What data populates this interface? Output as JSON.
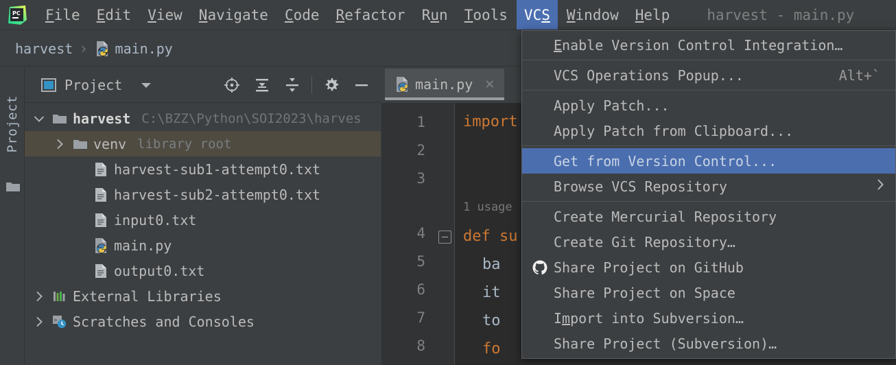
{
  "app": {
    "logo_icon": "pycharm-logo-icon",
    "window_title": "harvest - main.py"
  },
  "menubar": {
    "items": [
      {
        "label": "File",
        "mnemonic": "F",
        "active": false
      },
      {
        "label": "Edit",
        "mnemonic": "E",
        "active": false
      },
      {
        "label": "View",
        "mnemonic": "V",
        "active": false
      },
      {
        "label": "Navigate",
        "mnemonic": "N",
        "active": false
      },
      {
        "label": "Code",
        "mnemonic": "C",
        "active": false
      },
      {
        "label": "Refactor",
        "mnemonic": "R",
        "active": false
      },
      {
        "label": "Run",
        "mnemonic": "u",
        "active": false
      },
      {
        "label": "Tools",
        "mnemonic": "T",
        "active": false
      },
      {
        "label": "VCS",
        "mnemonic": "S",
        "active": true
      },
      {
        "label": "Window",
        "mnemonic": "W",
        "active": false
      },
      {
        "label": "Help",
        "mnemonic": "H",
        "active": false
      }
    ]
  },
  "breadcrumb": {
    "project": "harvest",
    "separator": "›",
    "file": "main.py",
    "file_icon": "python-file-icon"
  },
  "toolwindow_strip": {
    "label": "Project",
    "folder_icon": "folder-icon"
  },
  "project_panel": {
    "title": "Project",
    "title_icon": "project-view-icon",
    "dropdown_icon": "chevron-down-icon",
    "toolbar": [
      {
        "name": "locate-icon",
        "title": "Select Opened File"
      },
      {
        "name": "expand-all-icon",
        "title": "Expand All"
      },
      {
        "name": "collapse-all-icon",
        "title": "Collapse All"
      },
      {
        "name": "gear-icon",
        "title": "Settings"
      },
      {
        "name": "minimize-icon",
        "title": "Hide"
      }
    ],
    "tree": [
      {
        "label": "harvest",
        "detail": "C:\\BZZ\\Python\\SOI2023\\harves",
        "icon": "folder-icon",
        "arrow": "chevron-down-icon",
        "indent": 0,
        "bold": true,
        "selected": false
      },
      {
        "label": "venv",
        "detail": "library root",
        "icon": "folder-icon",
        "arrow": "chevron-right-icon",
        "indent": 1,
        "bold": false,
        "selected": true
      },
      {
        "label": "harvest-sub1-attempt0.txt",
        "detail": "",
        "icon": "text-file-icon",
        "arrow": "",
        "indent": 2,
        "bold": false,
        "selected": false
      },
      {
        "label": "harvest-sub2-attempt0.txt",
        "detail": "",
        "icon": "text-file-icon",
        "arrow": "",
        "indent": 2,
        "bold": false,
        "selected": false
      },
      {
        "label": "input0.txt",
        "detail": "",
        "icon": "text-file-icon",
        "arrow": "",
        "indent": 2,
        "bold": false,
        "selected": false
      },
      {
        "label": "main.py",
        "detail": "",
        "icon": "python-file-icon",
        "arrow": "",
        "indent": 2,
        "bold": false,
        "selected": false
      },
      {
        "label": "output0.txt",
        "detail": "",
        "icon": "text-file-icon",
        "arrow": "",
        "indent": 2,
        "bold": false,
        "selected": false
      },
      {
        "label": "External Libraries",
        "detail": "",
        "icon": "libraries-icon",
        "arrow": "chevron-right-icon",
        "indent": 0,
        "bold": false,
        "selected": false
      },
      {
        "label": "Scratches and Consoles",
        "detail": "",
        "icon": "scratches-icon",
        "arrow": "chevron-right-icon",
        "indent": 0,
        "bold": false,
        "selected": false
      }
    ]
  },
  "editor": {
    "tab": {
      "label": "main.py",
      "icon": "python-file-icon",
      "close_icon": "close-icon"
    },
    "line_numbers": [
      "1",
      "2",
      "3",
      "4",
      "5",
      "6",
      "7",
      "8"
    ],
    "usage_hint": "1 usage",
    "code_lines": [
      {
        "num": "1",
        "text": "import"
      },
      {
        "num": "4",
        "text": "def su"
      },
      {
        "num": "5",
        "text": "ba"
      },
      {
        "num": "6",
        "text": "it"
      },
      {
        "num": "7",
        "text": "to"
      },
      {
        "num": "8",
        "text": "fo"
      }
    ]
  },
  "vcs_menu": {
    "items": [
      {
        "type": "item",
        "label": "Enable Version Control Integration…",
        "mnemonic": "E",
        "shortcut": "",
        "icon": "",
        "submenu": false,
        "highlighted": false
      },
      {
        "type": "separator"
      },
      {
        "type": "item",
        "label": "VCS Operations Popup...",
        "mnemonic": "",
        "shortcut": "Alt+`",
        "icon": "",
        "submenu": false,
        "highlighted": false
      },
      {
        "type": "separator"
      },
      {
        "type": "item",
        "label": "Apply Patch...",
        "mnemonic": "",
        "shortcut": "",
        "icon": "",
        "submenu": false,
        "highlighted": false
      },
      {
        "type": "item",
        "label": "Apply Patch from Clipboard...",
        "mnemonic": "",
        "shortcut": "",
        "icon": "",
        "submenu": false,
        "highlighted": false
      },
      {
        "type": "separator"
      },
      {
        "type": "item",
        "label": "Get from Version Control...",
        "mnemonic": "",
        "shortcut": "",
        "icon": "",
        "submenu": false,
        "highlighted": true
      },
      {
        "type": "item",
        "label": "Browse VCS Repository",
        "mnemonic": "",
        "shortcut": "",
        "icon": "",
        "submenu": true,
        "highlighted": false
      },
      {
        "type": "separator"
      },
      {
        "type": "item",
        "label": "Create Mercurial Repository",
        "mnemonic": "",
        "shortcut": "",
        "icon": "",
        "submenu": false,
        "highlighted": false
      },
      {
        "type": "item",
        "label": "Create Git Repository…",
        "mnemonic": "",
        "shortcut": "",
        "icon": "",
        "submenu": false,
        "highlighted": false
      },
      {
        "type": "item",
        "label": "Share Project on GitHub",
        "mnemonic": "",
        "shortcut": "",
        "icon": "github-icon",
        "submenu": false,
        "highlighted": false
      },
      {
        "type": "item",
        "label": "Share Project on Space",
        "mnemonic": "",
        "shortcut": "",
        "icon": "",
        "submenu": false,
        "highlighted": false
      },
      {
        "type": "item",
        "label": "Import into Subversion…",
        "mnemonic": "m",
        "shortcut": "",
        "icon": "",
        "submenu": false,
        "highlighted": false
      },
      {
        "type": "item",
        "label": "Share Project (Subversion)…",
        "mnemonic": "",
        "shortcut": "",
        "icon": "",
        "submenu": false,
        "highlighted": false
      }
    ]
  },
  "colors": {
    "menu_highlight": "#4b6eaf",
    "tree_selection": "#4f4b41",
    "panel_bg": "#3c3f41",
    "editor_bg": "#2b2b2b",
    "gutter_bg": "#313335",
    "keyword": "#cc7832",
    "text": "#bbbbbb"
  }
}
